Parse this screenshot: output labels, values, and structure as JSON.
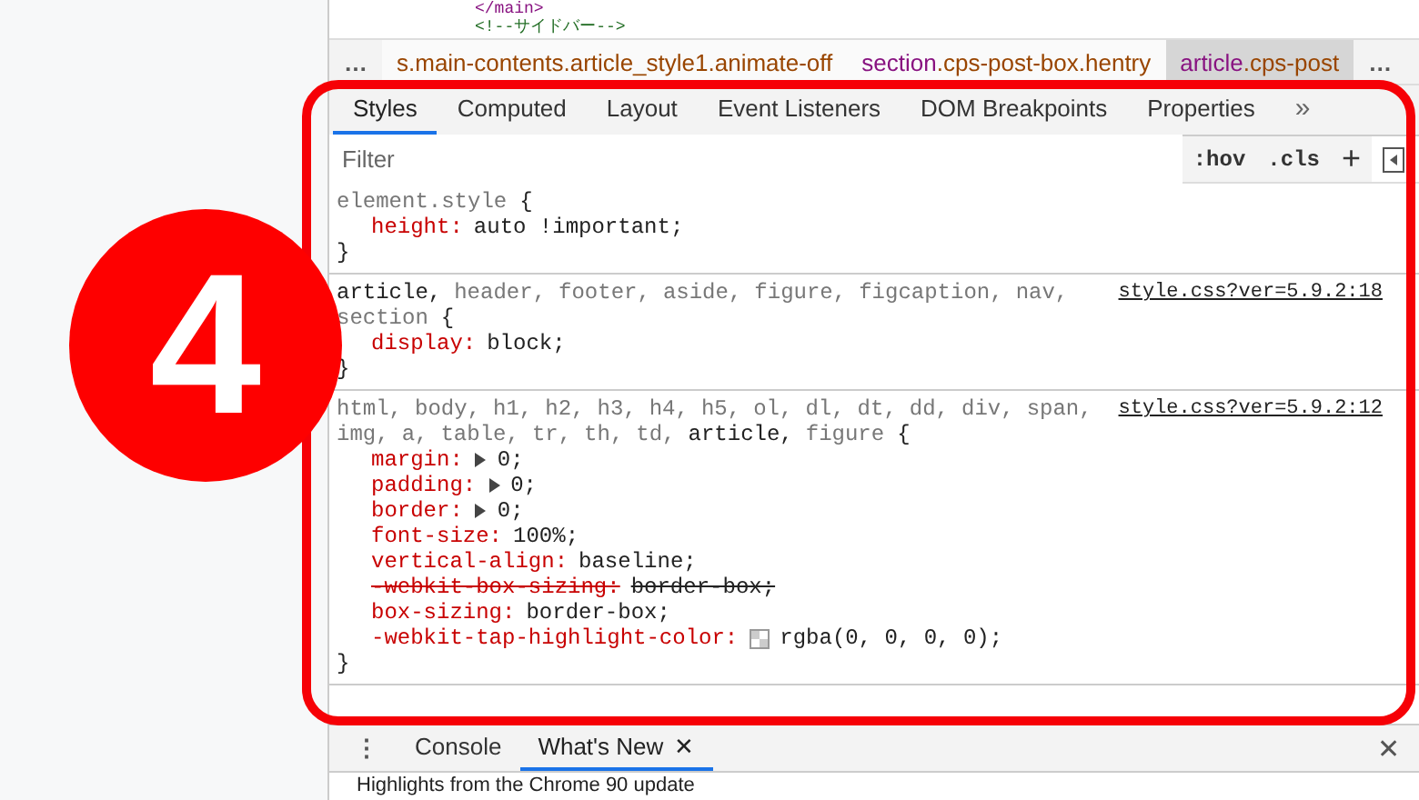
{
  "source_lines": [
    "</main>",
    "<!--サイドバー-->"
  ],
  "breadcrumbs": [
    {
      "text": "…",
      "kind": "ellipsis"
    },
    {
      "cls": "s.main-contents.article_style1.animate-off",
      "kind": "node",
      "selected": false
    },
    {
      "tag": "section",
      "cls": ".cps-post-box.hentry",
      "kind": "node",
      "selected": false
    },
    {
      "tag": "article",
      "cls": ".cps-post",
      "kind": "node",
      "selected": true
    },
    {
      "text": "…",
      "kind": "ellipsis"
    }
  ],
  "tabs": [
    {
      "label": "Styles",
      "selected": true
    },
    {
      "label": "Computed",
      "selected": false
    },
    {
      "label": "Layout",
      "selected": false
    },
    {
      "label": "Event Listeners",
      "selected": false
    },
    {
      "label": "DOM Breakpoints",
      "selected": false
    },
    {
      "label": "Properties",
      "selected": false
    }
  ],
  "tabs_more": "»",
  "filter": {
    "placeholder": "Filter",
    "hov": ":hov",
    "cls": ".cls",
    "add": "+"
  },
  "rules": [
    {
      "selector_lines": [
        [
          {
            "text": "element.style",
            "matched": false
          }
        ]
      ],
      "open": "{",
      "close": "}",
      "properties": [
        {
          "name": "height:",
          "value": "auto !important;",
          "expandable": false,
          "struck": false
        }
      ]
    },
    {
      "source": "style.css?ver=5.9.2:18",
      "selector_lines": [
        [
          {
            "text": "article,",
            "matched": true
          },
          {
            "text": "header,",
            "matched": false
          },
          {
            "text": "footer,",
            "matched": false
          },
          {
            "text": "aside,",
            "matched": false
          },
          {
            "text": "figure,",
            "matched": false
          },
          {
            "text": "figcaption,",
            "matched": false
          },
          {
            "text": "nav,",
            "matched": false
          }
        ],
        [
          {
            "text": "section",
            "matched": false
          }
        ]
      ],
      "open": "{",
      "close": "}",
      "properties": [
        {
          "name": "display:",
          "value": "block;",
          "expandable": false,
          "struck": false
        }
      ]
    },
    {
      "source": "style.css?ver=5.9.2:12",
      "selector_lines": [
        [
          {
            "text": "html,",
            "matched": false
          },
          {
            "text": "body,",
            "matched": false
          },
          {
            "text": "h1,",
            "matched": false
          },
          {
            "text": "h2,",
            "matched": false
          },
          {
            "text": "h3,",
            "matched": false
          },
          {
            "text": "h4,",
            "matched": false
          },
          {
            "text": "h5,",
            "matched": false
          },
          {
            "text": "ol,",
            "matched": false
          },
          {
            "text": "dl,",
            "matched": false
          },
          {
            "text": "dt,",
            "matched": false
          },
          {
            "text": "dd,",
            "matched": false
          },
          {
            "text": "div,",
            "matched": false
          },
          {
            "text": "span,",
            "matched": false
          }
        ],
        [
          {
            "text": "img,",
            "matched": false
          },
          {
            "text": "a,",
            "matched": false
          },
          {
            "text": "table,",
            "matched": false
          },
          {
            "text": "tr,",
            "matched": false
          },
          {
            "text": "th,",
            "matched": false
          },
          {
            "text": "td,",
            "matched": false
          },
          {
            "text": "article,",
            "matched": true
          },
          {
            "text": "figure",
            "matched": false
          }
        ]
      ],
      "open": "{",
      "close": "}",
      "properties": [
        {
          "name": "margin:",
          "value": "0;",
          "expandable": true,
          "struck": false
        },
        {
          "name": "padding:",
          "value": "0;",
          "expandable": true,
          "struck": false
        },
        {
          "name": "border:",
          "value": "0;",
          "expandable": true,
          "struck": false
        },
        {
          "name": "font-size:",
          "value": "100%;",
          "expandable": false,
          "struck": false
        },
        {
          "name": "vertical-align:",
          "value": "baseline;",
          "expandable": false,
          "struck": false
        },
        {
          "name": "-webkit-box-sizing:",
          "value": "border-box;",
          "expandable": false,
          "struck": true
        },
        {
          "name": "box-sizing:",
          "value": "border-box;",
          "expandable": false,
          "struck": false
        },
        {
          "name": "-webkit-tap-highlight-color:",
          "value": "rgba(0, 0, 0, 0);",
          "expandable": false,
          "struck": false,
          "swatch": true
        }
      ]
    }
  ],
  "drawer": {
    "menu": "⋮",
    "tabs": [
      {
        "label": "Console",
        "selected": false
      },
      {
        "label": "What's New",
        "close": "✕",
        "selected": true
      }
    ],
    "close": "✕",
    "content": "Highlights from the Chrome 90 update"
  },
  "annotation": {
    "number": "4"
  }
}
